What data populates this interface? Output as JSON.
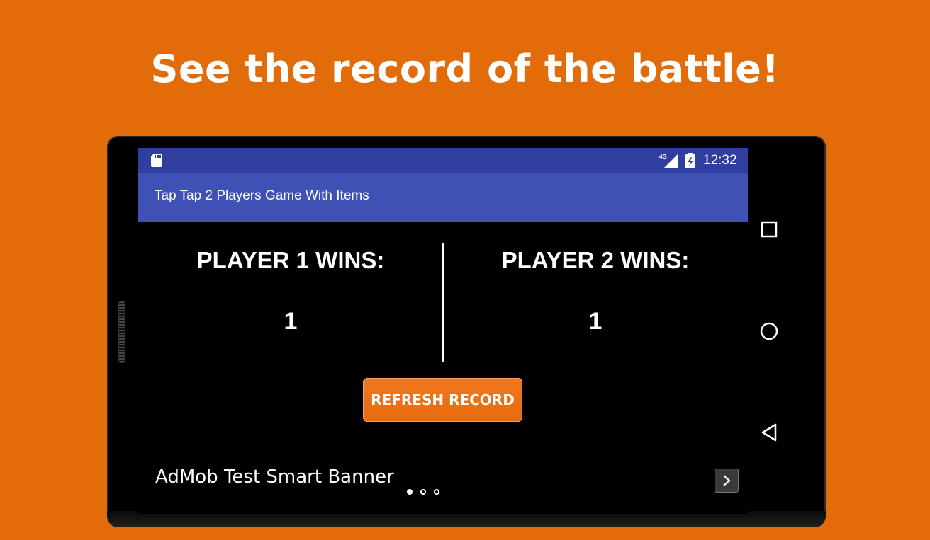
{
  "promo": {
    "title": "See the record of the battle!"
  },
  "status_bar": {
    "network": "4G",
    "time": "12:32",
    "icons": [
      "sd-card-icon",
      "signal-icon",
      "battery-icon"
    ]
  },
  "app_bar": {
    "title": "Tap Tap 2 Players Game With Items"
  },
  "record": {
    "player1_label": "PLAYER 1 WINS:",
    "player1_wins": "1",
    "player2_label": "PLAYER 2 WINS:",
    "player2_wins": "1",
    "refresh_label": "REFRESH RECORD"
  },
  "ad": {
    "text": "AdMob Test Smart Banner",
    "pages": 3,
    "active_page": 0
  },
  "nav": {
    "icons": [
      "recent-apps-icon",
      "home-icon",
      "back-icon"
    ]
  },
  "colors": {
    "background": "#E36C0A",
    "status_bar": "#303F9F",
    "app_bar": "#3F51B5",
    "button": "#EE7418"
  }
}
